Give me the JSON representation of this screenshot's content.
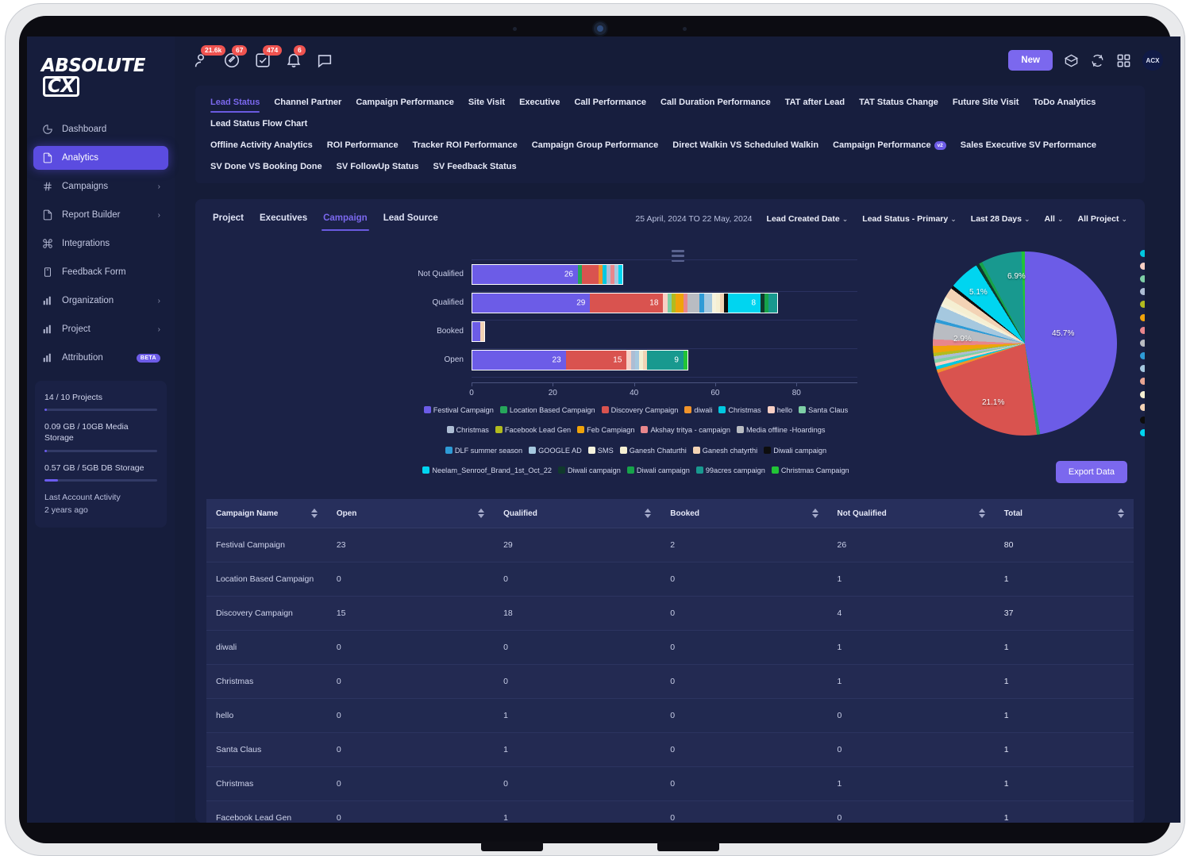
{
  "brand": {
    "name": "ABSOLUTE",
    "badge": "CX"
  },
  "sidebar": {
    "items": [
      {
        "label": "Dashboard",
        "icon": "pie-chart-icon",
        "caret": "",
        "badge": ""
      },
      {
        "label": "Analytics",
        "icon": "document-icon",
        "caret": "",
        "badge": ""
      },
      {
        "label": "Campaigns",
        "icon": "hash-icon",
        "caret": "›",
        "badge": ""
      },
      {
        "label": "Report Builder",
        "icon": "document-icon",
        "caret": "›",
        "badge": ""
      },
      {
        "label": "Integrations",
        "icon": "command-icon",
        "caret": "",
        "badge": ""
      },
      {
        "label": "Feedback Form",
        "icon": "form-icon",
        "caret": "",
        "badge": ""
      },
      {
        "label": "Organization",
        "icon": "bar-chart-icon",
        "caret": "›",
        "badge": ""
      },
      {
        "label": "Project",
        "icon": "bar-chart-icon",
        "caret": "›",
        "badge": ""
      },
      {
        "label": "Attribution",
        "icon": "bar-chart-icon",
        "caret": "",
        "badge": "BETA"
      }
    ],
    "active_index": 1,
    "usage": {
      "projects_label": "14 / 10 Projects",
      "projects_pct": 2,
      "media_label": "0.09 GB / 10GB Media Storage",
      "media_pct": 2,
      "db_label": "0.57 GB / 5GB DB Storage",
      "db_pct": 12,
      "activity_title": "Last Account Activity",
      "activity_value": "2 years ago"
    }
  },
  "topbar": {
    "icons": [
      {
        "name": "user-icon",
        "badge": "21.6k"
      },
      {
        "name": "compass-icon",
        "badge": "67"
      },
      {
        "name": "task-icon",
        "badge": "474"
      },
      {
        "name": "bell-icon",
        "badge": "6"
      },
      {
        "name": "chat-icon",
        "badge": ""
      }
    ],
    "new_label": "New",
    "right_icons": [
      "box-icon",
      "refresh-icon",
      "grid-icon"
    ],
    "avatar": "ACX"
  },
  "tabs": {
    "row1": [
      "Lead Status",
      "Channel Partner",
      "Campaign Performance",
      "Site Visit",
      "Executive",
      "Call Performance",
      "Call Duration Performance",
      "TAT after Lead",
      "TAT Status Change",
      "Future Site Visit",
      "ToDo Analytics",
      "Lead Status Flow Chart"
    ],
    "row2": [
      "Offline Activity Analytics",
      "ROI Performance",
      "Tracker ROI Performance",
      "Campaign Group Performance",
      "Direct Walkin VS Scheduled Walkin",
      "Campaign Performance",
      "Sales Executive SV Performance"
    ],
    "row2_v2_index": 5,
    "row2_v2_label": "v2",
    "row3": [
      "SV Done VS Booking Done",
      "SV FollowUp Status",
      "SV Feedback Status"
    ],
    "active": "Lead Status"
  },
  "card": {
    "subtabs": [
      "Project",
      "Executives",
      "Campaign",
      "Lead Source"
    ],
    "active_subtab": "Campaign",
    "date_range": "25 April, 2024 TO 22 May, 2024",
    "filters": [
      {
        "label": "Lead Created Date",
        "caret": "⌄"
      },
      {
        "label": "Lead Status - Primary",
        "caret": "⌄"
      },
      {
        "label": "Last 28 Days",
        "caret": "⌄"
      },
      {
        "label": "All",
        "caret": "⌄"
      },
      {
        "label": "All Project",
        "caret": "⌄"
      }
    ],
    "menu_icon": "hamburger-menu-icon",
    "export_label": "Export Data"
  },
  "chart_data": [
    {
      "type": "bar",
      "orientation": "horizontal",
      "stacked": true,
      "title": "",
      "xlabel": "",
      "ylabel": "",
      "xlim": [
        0,
        95
      ],
      "xticks": [
        0,
        20,
        40,
        60,
        80
      ],
      "categories": [
        "Not Qualified",
        "Qualified",
        "Booked",
        "Open"
      ],
      "grid": true,
      "legend_position": "bottom",
      "series": [
        {
          "name": "Festival Campaign",
          "color": "#6c5ce7",
          "values": [
            26,
            29,
            2,
            23
          ]
        },
        {
          "name": "Location Based Campaign",
          "color": "#26a65b",
          "values": [
            1,
            0,
            0,
            0
          ]
        },
        {
          "name": "Discovery Campaign",
          "color": "#d9534f",
          "values": [
            4,
            18,
            0,
            15
          ]
        },
        {
          "name": "diwali",
          "color": "#f0932b",
          "values": [
            1,
            0,
            0,
            0
          ]
        },
        {
          "name": "Christmas",
          "color": "#00c8e0",
          "values": [
            1,
            0,
            0,
            0
          ]
        },
        {
          "name": "hello",
          "color": "#f8cfc4",
          "values": [
            0,
            1,
            0,
            1
          ]
        },
        {
          "name": "Santa Claus",
          "color": "#7ecfa6",
          "values": [
            0,
            1,
            0,
            0
          ]
        },
        {
          "name": "Christmas",
          "color": "#adbdd4",
          "values": [
            1,
            0,
            0,
            1
          ]
        },
        {
          "name": "Facebook Lead Gen",
          "color": "#b2bb1e",
          "values": [
            0,
            1,
            0,
            0
          ]
        },
        {
          "name": "Feb Campiagn",
          "color": "#f0a30a",
          "values": [
            0,
            2,
            0,
            0
          ]
        },
        {
          "name": "Akshay tritya - campaign",
          "color": "#e8868c",
          "values": [
            1,
            1,
            0,
            0
          ]
        },
        {
          "name": "Media offline -Hoardings",
          "color": "#b9bcc2",
          "values": [
            0,
            3,
            0,
            0
          ]
        },
        {
          "name": "DLF summer season",
          "color": "#2e9bd6",
          "values": [
            0,
            1,
            0,
            0
          ]
        },
        {
          "name": "GOOGLE AD",
          "color": "#a5c8df",
          "values": [
            1,
            2,
            0,
            1
          ]
        },
        {
          "name": "SMS",
          "color": "#f5f2dd",
          "values": [
            0,
            1,
            0,
            0
          ]
        },
        {
          "name": "Ganesh Chaturthi",
          "color": "#f5efd2",
          "values": [
            0,
            1,
            0,
            1
          ]
        },
        {
          "name": "Ganesh chatyrthi",
          "color": "#f3d3b5",
          "values": [
            0,
            1,
            1,
            1
          ]
        },
        {
          "name": "Diwali campaign",
          "color": "#0d0d0d",
          "values": [
            0,
            1,
            0,
            0
          ]
        },
        {
          "name": "Neelam_Senroof_Brand_1st_Oct_22",
          "color": "#00d5f0",
          "values": [
            1,
            8,
            0,
            0
          ]
        },
        {
          "name": "Diwali campaign",
          "color": "#10392c",
          "values": [
            0,
            1,
            0,
            0
          ]
        },
        {
          "name": "Diwali campaign",
          "color": "#16a34a",
          "values": [
            0,
            1,
            0,
            0
          ]
        },
        {
          "name": "99acres campaign",
          "color": "#18998f",
          "values": [
            0,
            2,
            0,
            9
          ]
        },
        {
          "name": "Christmas Campaign",
          "color": "#22c436",
          "values": [
            0,
            0,
            0,
            1
          ]
        }
      ]
    },
    {
      "type": "pie",
      "title": "",
      "labels": [
        "Festival Campaign",
        "Location Based Campaign",
        "Discovery Campaign",
        "diwali",
        "Christmas",
        "hello",
        "Santa Claus",
        "Christmas",
        "Facebook Lead Gen",
        "Feb Campiagn",
        "Akshay tritya - campaign",
        "Media offline -Hoardings",
        "DLF summer season",
        "GOOGLE AD",
        "SMS",
        "Ganesh Chaturthi",
        "Ganesh chatyrthi",
        "Diwali campaign",
        "Neelam_Senroof_Brand_1st_Oct_22",
        "Diwali campaign",
        "Diwali campaign",
        "99acres campaign",
        "Christmas Campaign"
      ],
      "colors": [
        "#6c5ce7",
        "#26a65b",
        "#d9534f",
        "#f0932b",
        "#00c8e0",
        "#f8cfc4",
        "#7ecfa6",
        "#adbdd4",
        "#b2bb1e",
        "#f0a30a",
        "#e8868c",
        "#b9bcc2",
        "#2e9bd6",
        "#a5c8df",
        "#f5f2dd",
        "#f5efd2",
        "#f3d3b5",
        "#0d0d0d",
        "#00d5f0",
        "#10392c",
        "#16a34a",
        "#18998f",
        "#22c436"
      ],
      "values": [
        80,
        1,
        37,
        1,
        1,
        1,
        1,
        1,
        1,
        2,
        2,
        5,
        1,
        4,
        1,
        2,
        3,
        1,
        9,
        1,
        1,
        12,
        1
      ],
      "visible_labels": [
        {
          "text": "45.7%",
          "slice": "Festival Campaign"
        },
        {
          "text": "21.1%",
          "slice": "Discovery Campaign"
        },
        {
          "text": "2.9%",
          "slice": "Media offline -Hoardings"
        },
        {
          "text": "5.1%",
          "slice": "Neelam_Senroof_Brand_1st_Oct_22"
        },
        {
          "text": "6.9%",
          "slice": "99acres campaign"
        }
      ],
      "legend_position": "right",
      "legend_visible": [
        {
          "label": "Christmas",
          "color": "#00c8e0"
        },
        {
          "label": "hello",
          "color": "#f8cfc4"
        },
        {
          "label": "Santa Claus",
          "color": "#7ecfa6"
        },
        {
          "label": "Christmas",
          "color": "#adbdd4"
        },
        {
          "label": "Facebook Lead Gen",
          "color": "#b2bb1e"
        },
        {
          "label": "Feb Campiagn",
          "color": "#f0a30a"
        },
        {
          "label": "Akshay tritya - campaign",
          "color": "#e8868c"
        },
        {
          "label": "Media offline -Hoardings",
          "color": "#b9bcc2"
        },
        {
          "label": "DLF summer season",
          "color": "#2e9bd6"
        },
        {
          "label": "GOOGLE AD",
          "color": "#a5c8df"
        },
        {
          "label": "SMS",
          "color": "#e8a593"
        },
        {
          "label": "Ganesh Chaturthi",
          "color": "#f5efd2"
        },
        {
          "label": "Ganesh chatyrthi",
          "color": "#f3d3b5"
        },
        {
          "label": "Diwali campaign",
          "color": "#0d0d0d"
        },
        {
          "label": "Neelam_Senroof_Brand_1st_Oct_22",
          "color": "#00d5f0"
        }
      ]
    }
  ],
  "table": {
    "columns": [
      "Campaign Name",
      "Open",
      "Qualified",
      "Booked",
      "Not Qualified",
      "Total"
    ],
    "rows": [
      {
        "name": "Festival Campaign",
        "open": "23",
        "qualified": "29",
        "booked": "2",
        "not_qualified": "26",
        "total": "80"
      },
      {
        "name": "Location Based Campaign",
        "open": "0",
        "qualified": "0",
        "booked": "0",
        "not_qualified": "1",
        "total": "1"
      },
      {
        "name": "Discovery Campaign",
        "open": "15",
        "qualified": "18",
        "booked": "0",
        "not_qualified": "4",
        "total": "37"
      },
      {
        "name": "diwali",
        "open": "0",
        "qualified": "0",
        "booked": "0",
        "not_qualified": "1",
        "total": "1"
      },
      {
        "name": "Christmas",
        "open": "0",
        "qualified": "0",
        "booked": "0",
        "not_qualified": "1",
        "total": "1"
      },
      {
        "name": "hello",
        "open": "0",
        "qualified": "1",
        "booked": "0",
        "not_qualified": "0",
        "total": "1"
      },
      {
        "name": "Santa Claus",
        "open": "0",
        "qualified": "1",
        "booked": "0",
        "not_qualified": "0",
        "total": "1"
      },
      {
        "name": "Christmas",
        "open": "0",
        "qualified": "0",
        "booked": "0",
        "not_qualified": "1",
        "total": "1"
      },
      {
        "name": "Facebook Lead Gen",
        "open": "0",
        "qualified": "1",
        "booked": "0",
        "not_qualified": "0",
        "total": "1"
      }
    ]
  }
}
